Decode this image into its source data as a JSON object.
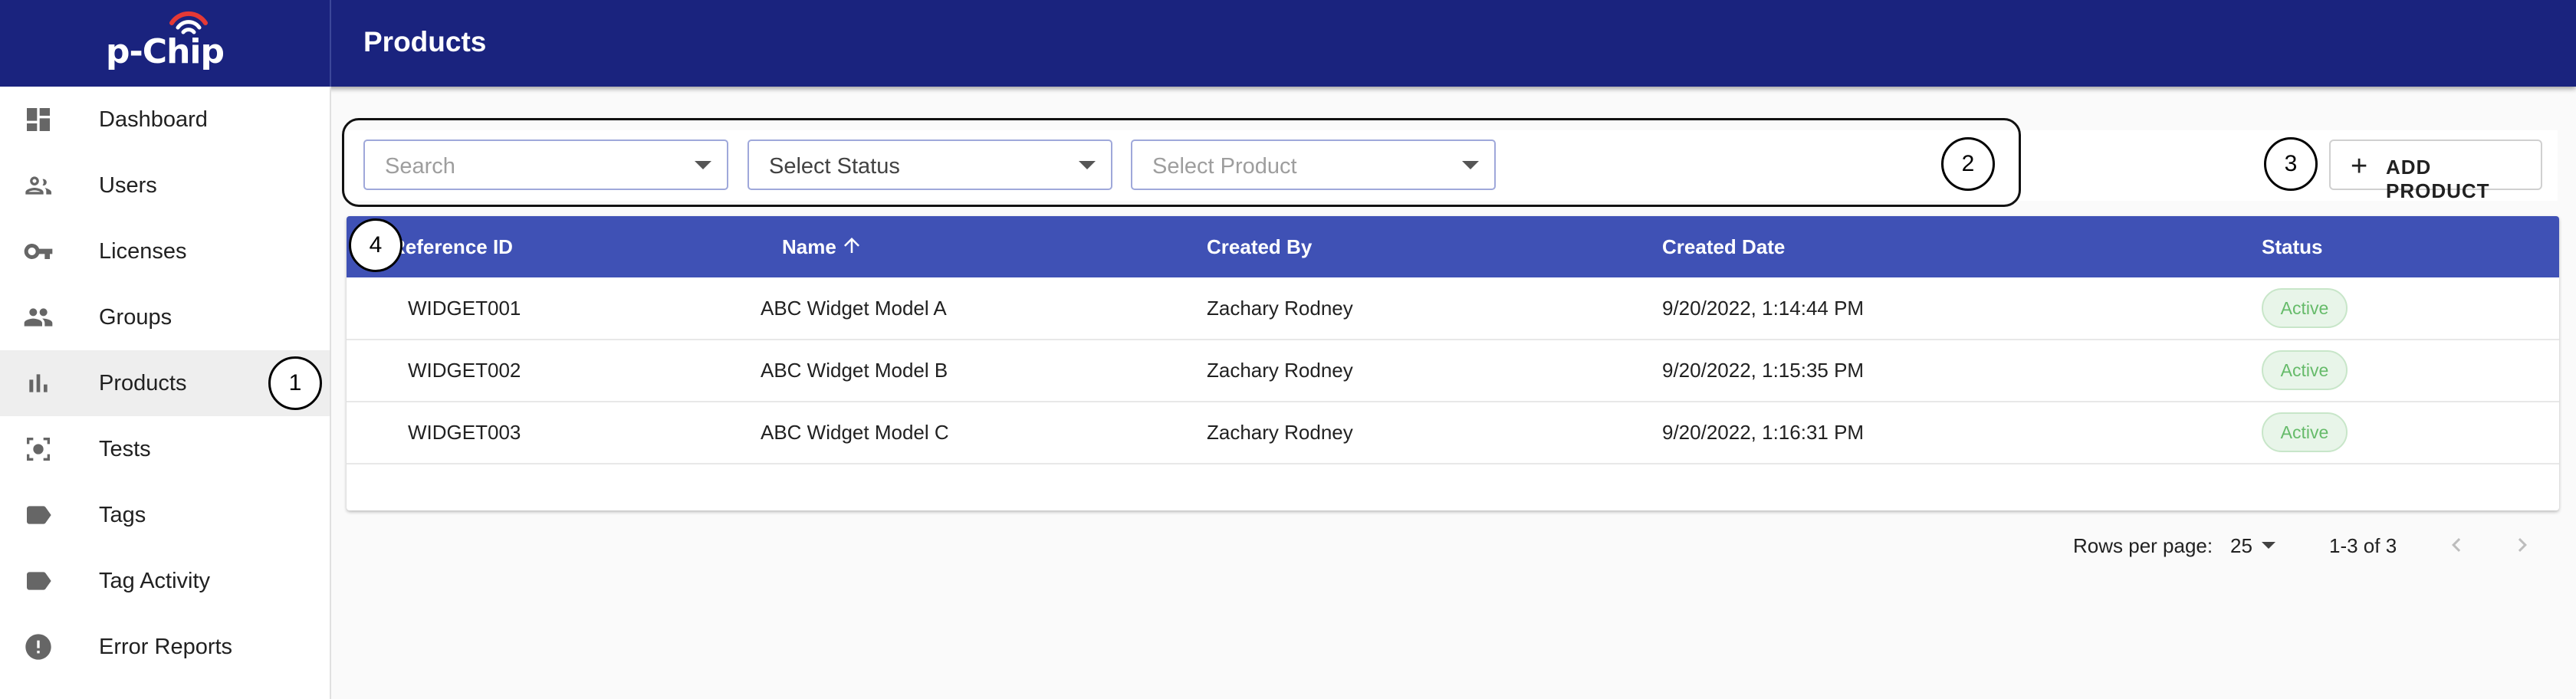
{
  "app": {
    "logo_text": "p-Chip"
  },
  "header": {
    "title": "Products"
  },
  "sidebar": {
    "items": [
      {
        "label": "Dashboard",
        "icon": "dashboard-icon"
      },
      {
        "label": "Users",
        "icon": "users-icon"
      },
      {
        "label": "Licenses",
        "icon": "key-icon"
      },
      {
        "label": "Groups",
        "icon": "groups-icon"
      },
      {
        "label": "Products",
        "icon": "bar-chart-icon",
        "active": true
      },
      {
        "label": "Tests",
        "icon": "test-icon"
      },
      {
        "label": "Tags",
        "icon": "tag-icon"
      },
      {
        "label": "Tag Activity",
        "icon": "tag-icon"
      },
      {
        "label": "Error Reports",
        "icon": "error-icon"
      }
    ]
  },
  "filters": {
    "search": {
      "placeholder": "Search"
    },
    "status": {
      "value": "Select Status"
    },
    "product": {
      "placeholder": "Select Product"
    }
  },
  "actions": {
    "add_label": "ADD PRODUCT"
  },
  "callouts": [
    "1",
    "2",
    "3",
    "4"
  ],
  "table": {
    "columns": [
      "Reference ID",
      "Name",
      "Created By",
      "Created Date",
      "Status"
    ],
    "sort": {
      "column": "Name",
      "direction": "ascending"
    },
    "rows": [
      {
        "ref": "WIDGET001",
        "name": "ABC Widget Model A",
        "created_by": "Zachary Rodney",
        "created_date": "9/20/2022, 1:14:44 PM",
        "status": "Active"
      },
      {
        "ref": "WIDGET002",
        "name": "ABC Widget Model B",
        "created_by": "Zachary Rodney",
        "created_date": "9/20/2022, 1:15:35 PM",
        "status": "Active"
      },
      {
        "ref": "WIDGET003",
        "name": "ABC Widget Model C",
        "created_by": "Zachary Rodney",
        "created_date": "9/20/2022, 1:16:31 PM",
        "status": "Active"
      }
    ]
  },
  "pagination": {
    "rows_per_page_label": "Rows per page:",
    "rows_per_page": "25",
    "range": "1-3 of 3"
  },
  "colors": {
    "appbar": "#1a237e",
    "table_header": "#3f51b5",
    "status_active_text": "#66bb6a",
    "status_active_bg": "#e8f5e9",
    "logo_accent": "#e53935"
  }
}
